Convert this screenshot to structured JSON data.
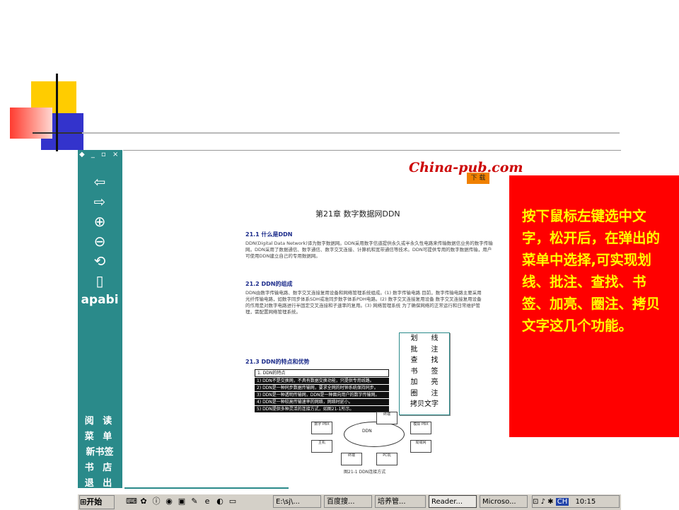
{
  "callout": {
    "text": "按下鼠标左键选中文字，松开后，在弹出的菜单中选择,可实现划线、批注、查找、书签、加亮、圈注、拷贝文字这几个功能。"
  },
  "reader": {
    "window_controls": "◆ _ ▫ ×",
    "sidebar_brand": "apabi",
    "sidebar_menu": [
      "阅 读",
      "菜 单",
      "新书签",
      "书 店",
      "退 出"
    ],
    "logo_text": "China-pub.com",
    "logo_button": "下 载"
  },
  "document": {
    "chapter_title": "第21章  数字数据网DDN",
    "sections": [
      {
        "heading": "21.1  什么是DDN",
        "body": "DDN(Digital Data Network)译为数字数据网。DDN采用数字信道提供永久或半永久性电路来传输数据信业务的数字传输网。DDN采用了数据通信、数字通信、数字交叉连接、计算机和宽带通信等技术。DDN可提供专用的数字数据传输，用户可使用DDN建立自己的专用数据网。"
      },
      {
        "heading": "21.2  DDN的组成",
        "body": "DDN由数字传输电路、数字交叉连接复用设备和网络管理系统组成。(1) 数字传输电路  目前，数字传输电路主要采用光纤传输电路，如数字同步体系SDH或准同步数字体系PDH电路。(2) 数字交叉连接复用设备  数字交叉连接复用设备的作用是对数字电路进行半固定交叉连接和子速率的复用。(3) 网络管理系统  为了确保网络的正常运行和日常维护管理，需配置网络管理系统。"
      },
      {
        "heading": "21.3  DDN的特点和优势",
        "body": ""
      }
    ],
    "feature_rows": [
      "1. DDN的特点",
      "1) DDN不是交换网，不具有数据交换功能，只提供专用线路。",
      "2) DDN是一种同步数据传输网，要求全网的时钟系统保持同步。",
      "3) DDN是一种透明传输网，DDN是一种面向用户的数字传输网。",
      "4) DDN是一种较高传输速率的网络，网络时延小。",
      "5) DDN提供多种灵活的连接方式，如图21-1所示。"
    ],
    "diagram": {
      "center": "DDN",
      "nodes": [
        "数字 PBX",
        "主机",
        "终端",
        "PC机",
        "模拟 PBX",
        "局域网",
        "终端"
      ],
      "caption": "图21-1  DDN连接方式"
    }
  },
  "context_menu": {
    "items": [
      [
        "划",
        "线"
      ],
      [
        "批",
        "注"
      ],
      [
        "查",
        "找"
      ],
      [
        "书",
        "签"
      ],
      [
        "加",
        "亮"
      ],
      [
        "圈",
        "注"
      ],
      [
        "拷贝文字",
        ""
      ]
    ]
  },
  "taskbar": {
    "start_label": "开始",
    "tasks": [
      "E:\\sj\\...",
      "百度搜...",
      "培养管...",
      "Reader...",
      "Microso..."
    ],
    "tray_lang": "CH",
    "clock": "10:15"
  }
}
